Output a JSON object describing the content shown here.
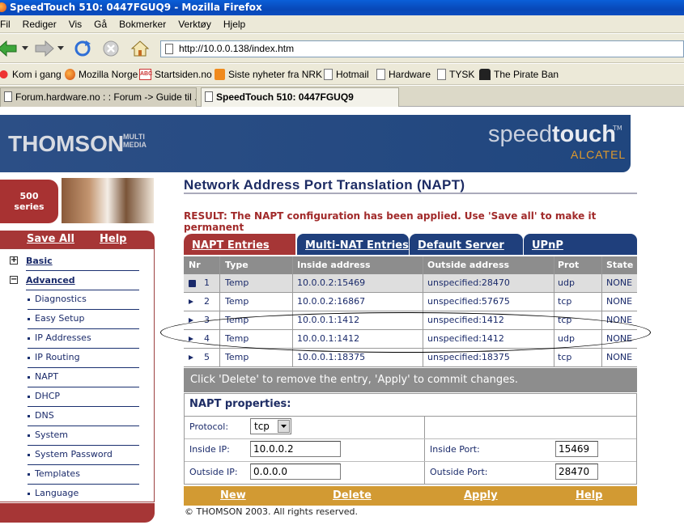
{
  "window": {
    "title": "SpeedTouch 510:  0447FGUQ9 - Mozilla Firefox"
  },
  "menu": [
    "Fil",
    "Rediger",
    "Vis",
    "Gå",
    "Bokmerker",
    "Verktøy",
    "Hjelp"
  ],
  "url": "http://10.0.0.138/index.htm",
  "bookmarks": [
    "Kom i gang",
    "Mozilla Norge",
    "Startsiden.no",
    "Siste nyheter fra NRK",
    "Hotmail",
    "Hardware",
    "TYSK",
    "The Pirate Ban"
  ],
  "tabs": [
    "Forum.hardware.no : : Forum -> Guide til ...",
    "SpeedTouch 510:  0447FGUQ9"
  ],
  "brand": {
    "left": "THOMSON",
    "left_sub": "MULTI MEDIA",
    "right_light": "speed",
    "right_bold": "touch",
    "tm": "TM",
    "right_sub": "ALCATEL",
    "series_num": "500",
    "series_word": "series"
  },
  "sidebar": {
    "save_all": "Save All",
    "help": "Help",
    "basic": "Basic",
    "advanced": "Advanced",
    "items": [
      "Diagnostics",
      "Easy Setup",
      "IP Addresses",
      "IP Routing",
      "NAPT",
      "DHCP",
      "DNS",
      "System",
      "System Password",
      "Templates",
      "Language"
    ]
  },
  "main": {
    "title": "Network Address Port Translation (NAPT)",
    "result": "RESULT: The NAPT configuration has been applied. Use 'Save all' to make it permanent",
    "tabs": [
      "NAPT Entries",
      "Multi-NAT Entries",
      "Default Server",
      "UPnP"
    ],
    "columns": [
      "Nr",
      "Type",
      "Inside address",
      "Outside address",
      "Prot",
      "State"
    ],
    "rows": [
      {
        "nr": "1",
        "type": "Temp",
        "inside": "10.0.0.2:15469",
        "outside": "unspecified:28470",
        "prot": "udp",
        "state": "NONE"
      },
      {
        "nr": "2",
        "type": "Temp",
        "inside": "10.0.0.2:16867",
        "outside": "unspecified:57675",
        "prot": "tcp",
        "state": "NONE"
      },
      {
        "nr": "3",
        "type": "Temp",
        "inside": "10.0.0.1:1412",
        "outside": "unspecified:1412",
        "prot": "tcp",
        "state": "NONE"
      },
      {
        "nr": "4",
        "type": "Temp",
        "inside": "10.0.0.1:1412",
        "outside": "unspecified:1412",
        "prot": "udp",
        "state": "NONE"
      },
      {
        "nr": "5",
        "type": "Temp",
        "inside": "10.0.0.1:18375",
        "outside": "unspecified:18375",
        "prot": "tcp",
        "state": "NONE"
      }
    ],
    "hint": "Click 'Delete' to remove the entry, 'Apply' to commit changes.",
    "properties": {
      "title": "NAPT properties:",
      "protocol_label": "Protocol:",
      "protocol_value": "tcp",
      "inside_ip_label": "Inside IP:",
      "inside_ip": "10.0.0.2",
      "inside_port_label": "Inside Port:",
      "inside_port": "15469",
      "outside_ip_label": "Outside IP:",
      "outside_ip": "0.0.0.0",
      "outside_port_label": "Outside Port:",
      "outside_port": "28470"
    },
    "actions": [
      "New",
      "Delete",
      "Apply",
      "Help"
    ],
    "copyright": "© THOMSON 2003. All rights reserved."
  },
  "colors": {
    "brand_blue": "#20467e",
    "brand_red": "#a63636",
    "accent_gold": "#d29a33",
    "result_red": "#a12a2a"
  }
}
